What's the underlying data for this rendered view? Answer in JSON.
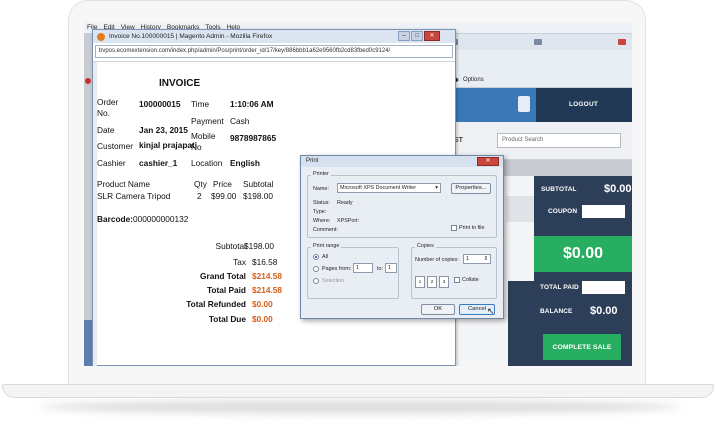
{
  "browser": {
    "menu": [
      "File",
      "Edit",
      "View",
      "History",
      "Bookmarks",
      "Tools",
      "Help"
    ],
    "toolbar_right": "Options"
  },
  "pos": {
    "logout": "LOGOUT",
    "list_label": "ST",
    "search_placeholder": "Product Search",
    "subtotal_label": "SUBTOTAL",
    "subtotal_value": "$0.00",
    "coupon_label": "COUPON",
    "total_value": "$0.00",
    "total_paid_label": "TOTAL PAID",
    "balance_label": "BALANCE",
    "balance_value": "$0.00",
    "complete_sale": "COMPLETE SALE",
    "colors": {
      "header": "#223955",
      "panel": "#2d3f58",
      "green": "#27ae61"
    }
  },
  "invoice_window": {
    "title": "Invoice No.100000015 | Magento Admin - Mozilla Firefox",
    "url": "bvpos.ecomextension.com/index.php/admin/Pos/print/order_id/17/key/886bbb1a62e9560fb2cd83fbed0c9124/",
    "heading": "INVOICE",
    "order_label": "Order No.",
    "order_value": "100000015",
    "time_label": "Time",
    "time_value": "1:10:06 AM",
    "date_label": "Date",
    "date_value": "Jan 23, 2015",
    "payment_label": "Payment",
    "payment_value": "Cash",
    "customer_label": "Customer",
    "customer_value": "kinjal prajapati",
    "mobile_label": "Mobile No",
    "mobile_value": "9878987865",
    "cashier_label": "Cashier",
    "cashier_value": "cashier_1",
    "location_label": "Location",
    "location_value": "English",
    "col_product": "Product Name",
    "col_qty": "Qty",
    "col_price": "Price",
    "col_subtotal": "Subtotal",
    "item_name": "SLR Camera Tripod",
    "item_qty": "2",
    "item_price": "$99.00",
    "item_subtotal": "$198.00",
    "barcode_label": "Barcode:",
    "barcode_value": "000000000132",
    "subtotal_label": "Subtotal",
    "subtotal_value": "$198.00",
    "tax_label": "Tax",
    "tax_value": "$16.58",
    "grand_total_label": "Grand Total",
    "grand_total_value": "$214.58",
    "total_paid_label": "Total Paid",
    "total_paid_value": "$214.58",
    "total_refunded_label": "Total Refunded",
    "total_refunded_value": "$0.00",
    "total_due_label": "Total Due",
    "total_due_value": "$0.00"
  },
  "print_dialog": {
    "title": "Print",
    "printer_group": "Printer",
    "name_label": "Name:",
    "printer_name": "Microsoft XPS Document Writer",
    "properties": "Properties...",
    "status_label": "Status:",
    "status_value": "Ready",
    "type_label": "Type:",
    "where_label": "Where:",
    "where_value": "XPSPort:",
    "comment_label": "Comment:",
    "print_to_file": "Print to file",
    "range_label": "Print range",
    "all": "All",
    "pages": "Pages",
    "from_label": "from:",
    "from_value": "1",
    "to_label": "to:",
    "to_value": "1",
    "selection": "Selection",
    "copies_label": "Copies",
    "num_copies_label": "Number of copies:",
    "num_copies_value": "1",
    "collate": "Collate",
    "ok": "OK",
    "cancel": "Cancel"
  }
}
